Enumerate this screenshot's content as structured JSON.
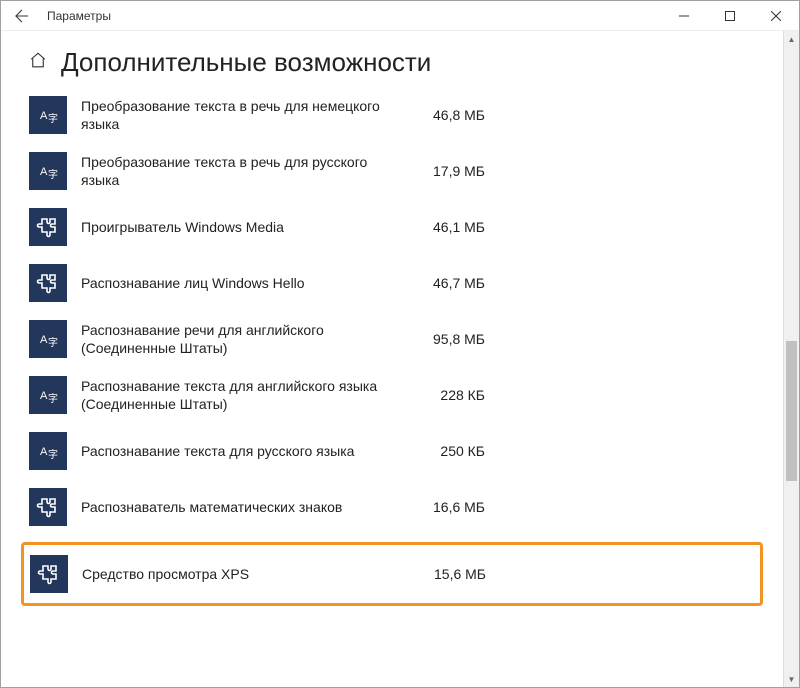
{
  "window": {
    "title": "Параметры"
  },
  "page": {
    "title": "Дополнительные возможности"
  },
  "features": [
    {
      "icon": "lang",
      "name": "Преобразование текста в речь для немецкого языка",
      "size": "46,8 МБ",
      "highlighted": false
    },
    {
      "icon": "lang",
      "name": "Преобразование текста в речь для русского языка",
      "size": "17,9 МБ",
      "highlighted": false
    },
    {
      "icon": "puzzle",
      "name": "Проигрыватель Windows Media",
      "size": "46,1 МБ",
      "highlighted": false
    },
    {
      "icon": "puzzle",
      "name": "Распознавание лиц Windows Hello",
      "size": "46,7 МБ",
      "highlighted": false
    },
    {
      "icon": "lang",
      "name": "Распознавание речи для английского (Соединенные Штаты)",
      "size": "95,8 МБ",
      "highlighted": false
    },
    {
      "icon": "lang",
      "name": "Распознавание текста для английского языка (Соединенные Штаты)",
      "size": "228 КБ",
      "highlighted": false
    },
    {
      "icon": "lang",
      "name": "Распознавание текста для русского языка",
      "size": "250 КБ",
      "highlighted": false
    },
    {
      "icon": "puzzle",
      "name": "Распознаватель математических знаков",
      "size": "16,6 МБ",
      "highlighted": false
    },
    {
      "icon": "puzzle",
      "name": "Средство просмотра XPS",
      "size": "15,6 МБ",
      "highlighted": true
    }
  ]
}
